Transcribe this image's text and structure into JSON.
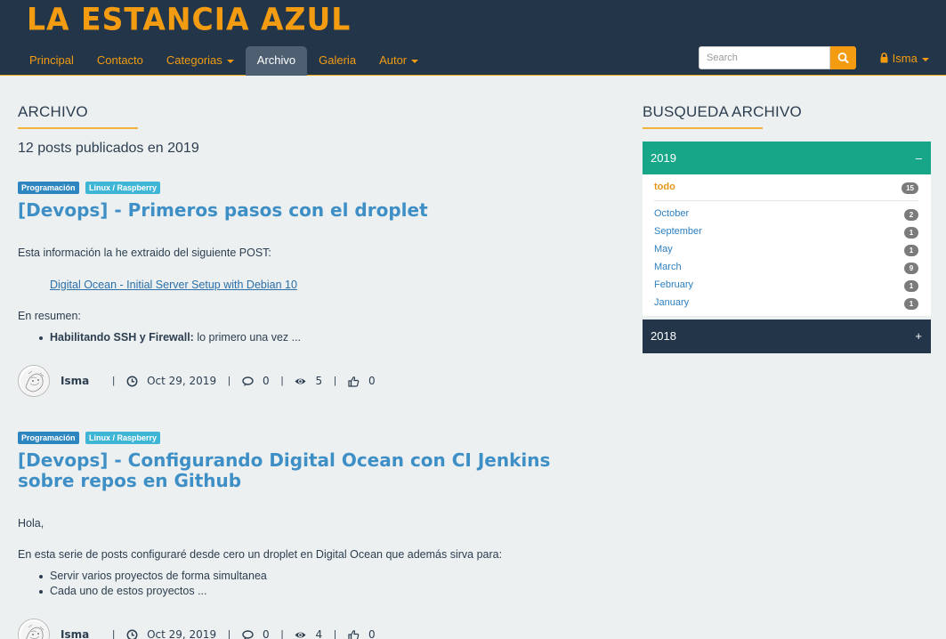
{
  "header": {
    "brand": "LA ESTANCIA AZUL",
    "nav": [
      {
        "label": "Principal"
      },
      {
        "label": "Contacto"
      },
      {
        "label": "Categorias"
      },
      {
        "label": "Archivo"
      },
      {
        "label": "Galeria"
      },
      {
        "label": "Autor"
      }
    ],
    "search": {
      "placeholder": "Search"
    },
    "user": {
      "name": "Isma"
    }
  },
  "main": {
    "title": "ARCHIVO",
    "post_count": "12 posts publicados en 2019",
    "posts": [
      {
        "tags": [
          "Programación",
          "Linux / Raspberry"
        ],
        "title": "[Devops] - Primeros pasos con el droplet",
        "intro": "Esta información la he extraido del siguiente POST:",
        "link": "Digital Ocean - Initial Server Setup with Debian 10",
        "summary": "En resumen:",
        "bullet_bold": "Habilitando SSH y Firewall:",
        "bullet_rest": " lo primero una vez ...",
        "author": "Isma",
        "date": "Oct 29, 2019",
        "comments": "0",
        "views": "5",
        "likes": "0"
      },
      {
        "tags": [
          "Programación",
          "Linux / Raspberry"
        ],
        "title": "[Devops] - Configurando Digital Ocean con CI Jenkins sobre repos en Github",
        "greeting": "Hola,",
        "intro": "En esta serie de posts configuraré desde cero un droplet en Digital Ocean que además sirva para:",
        "bullets": [
          "Servir varios proyectos de forma simultanea",
          "Cada uno de estos proyectos ..."
        ],
        "author": "Isma",
        "date": "Oct 29, 2019",
        "comments": "0",
        "views": "4",
        "likes": "0"
      }
    ]
  },
  "sidebar": {
    "title": "BUSQUEDA ARCHIVO",
    "years": [
      {
        "year": "2019",
        "sign": "–",
        "all_label": "todo",
        "all_count": "15",
        "months": [
          {
            "label": "October",
            "count": "2"
          },
          {
            "label": "September",
            "count": "1"
          },
          {
            "label": "May",
            "count": "1"
          },
          {
            "label": "March",
            "count": "9"
          },
          {
            "label": "February",
            "count": "1"
          },
          {
            "label": "January",
            "count": "1"
          }
        ]
      },
      {
        "year": "2018",
        "sign": "+"
      }
    ]
  },
  "colors": {
    "header_bg": "#223549",
    "accent": "#f39c12",
    "link": "#3d8fc6",
    "open_panel": "#18a689"
  },
  "icons": {
    "search": "search-icon",
    "lock": "lock-icon",
    "clock": "clock-icon",
    "comment": "comment-icon",
    "eye": "eye-icon",
    "thumbs_up": "thumbs-up-icon"
  }
}
